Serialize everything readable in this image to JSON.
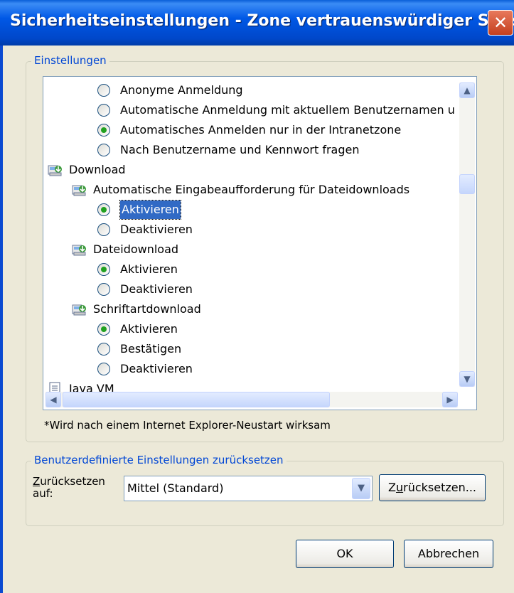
{
  "window": {
    "title": "Sicherheitseinstellungen - Zone vertrauenswürdiger Sites",
    "close_glyph": "✕"
  },
  "settings_group": {
    "label": "Einstellungen",
    "rows": [
      {
        "type": "radio",
        "label": "Anonyme Anmeldung",
        "checked": false
      },
      {
        "type": "radio",
        "label": "Automatische Anmeldung mit aktuellem Benutzernamen u",
        "checked": false
      },
      {
        "type": "radio",
        "label": "Automatisches Anmelden nur in der Intranetzone",
        "checked": true
      },
      {
        "type": "radio",
        "label": "Nach Benutzername und Kennwort fragen",
        "checked": false
      },
      {
        "type": "category",
        "label": "Download"
      },
      {
        "type": "category",
        "label": "Automatische Eingabeaufforderung für Dateidownloads"
      },
      {
        "type": "radio",
        "label": "Aktivieren",
        "checked": true,
        "focused": true
      },
      {
        "type": "radio",
        "label": "Deaktivieren",
        "checked": false
      },
      {
        "type": "category",
        "label": "Dateidownload"
      },
      {
        "type": "radio",
        "label": "Aktivieren",
        "checked": true
      },
      {
        "type": "radio",
        "label": "Deaktivieren",
        "checked": false
      },
      {
        "type": "category",
        "label": "Schriftartdownload"
      },
      {
        "type": "radio",
        "label": "Aktivieren",
        "checked": true
      },
      {
        "type": "radio",
        "label": "Bestätigen",
        "checked": false
      },
      {
        "type": "radio",
        "label": "Deaktivieren",
        "checked": false
      },
      {
        "type": "category",
        "label": "Java VM"
      }
    ],
    "scroll_position": 0.3,
    "restart_note": "*Wird nach einem Internet Explorer-Neustart wirksam"
  },
  "reset_group": {
    "label": "Benutzerdefinierte Einstellungen zurücksetzen",
    "reset_label_prefix": "Z",
    "reset_label_rest": "urücksetzen",
    "reset_label_line2": "auf:",
    "combo_value": "Mittel (Standard)",
    "reset_button_prefix": "Z",
    "reset_button_mnemonic": "u",
    "reset_button_rest": "rücksetzen..."
  },
  "buttons": {
    "ok": "OK",
    "cancel": "Abbrechen"
  },
  "colors": {
    "title_bar": "#0058e6",
    "group_label": "#0046d5",
    "radio_check": "#21a121"
  }
}
